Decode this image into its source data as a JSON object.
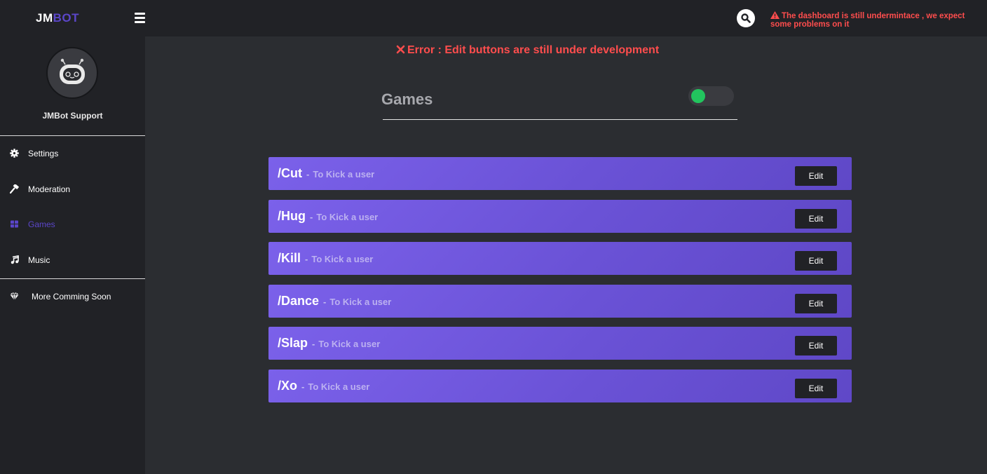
{
  "brand": {
    "part1": "JM",
    "part2": "BOT"
  },
  "topbar": {
    "warning_text": "The dashboard is still undermintace , we expect some problems on it"
  },
  "sidebar": {
    "profile_name": "JMBot Support",
    "items": [
      {
        "label": "Settings",
        "icon": "gear-icon"
      },
      {
        "label": "Moderation",
        "icon": "hammer-icon"
      },
      {
        "label": "Games",
        "icon": "table-icon",
        "active": true
      },
      {
        "label": "Music",
        "icon": "music-note-icon"
      },
      {
        "label": "More Comming Soon",
        "icon": "diamond-icon"
      }
    ]
  },
  "main": {
    "error_text": "Error : Edit buttons are still under development",
    "section_title": "Games",
    "toggle_on": true,
    "commands": [
      {
        "name": "/Cut",
        "sep": "-",
        "desc": "To Kick a user",
        "button": "Edit"
      },
      {
        "name": "/Hug",
        "sep": "-",
        "desc": "To Kick a user",
        "button": "Edit"
      },
      {
        "name": "/Kill",
        "sep": "-",
        "desc": "To Kick a user",
        "button": "Edit"
      },
      {
        "name": "/Dance",
        "sep": "-",
        "desc": "To Kick a user",
        "button": "Edit"
      },
      {
        "name": "/Slap",
        "sep": "-",
        "desc": "To Kick a user",
        "button": "Edit"
      },
      {
        "name": "/Xo",
        "sep": "-",
        "desc": "To Kick a user",
        "button": "Edit"
      }
    ]
  },
  "colors": {
    "accent": "#5b46c9",
    "row": "#6f56dd",
    "error": "#ff4d4d",
    "toggle_on": "#22c55e"
  }
}
